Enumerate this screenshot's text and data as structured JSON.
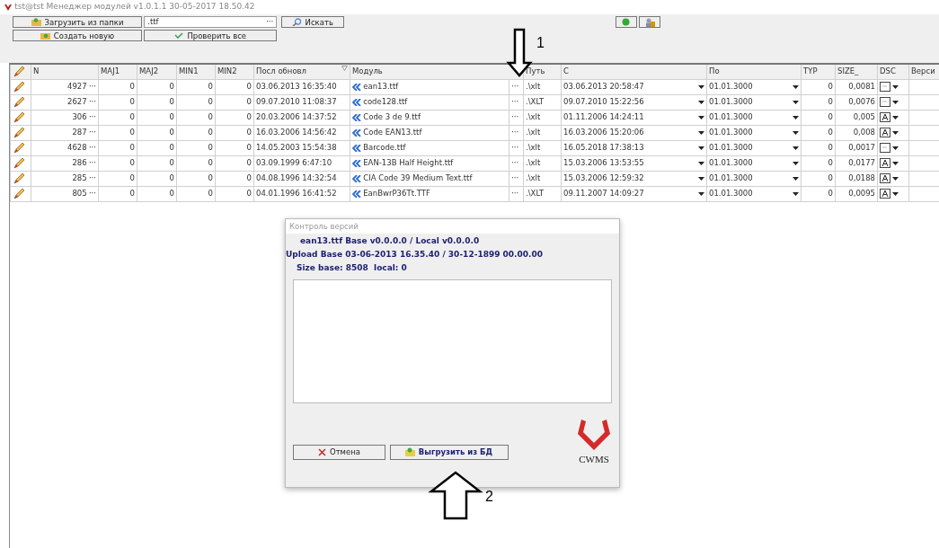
{
  "window": {
    "title": "tst@tst Менеджер модулей v1.0.1.1 30-05-2017 18.50.42"
  },
  "toolbar": {
    "load_button": "Загрузить из папки",
    "filter": {
      "value": ".ttf",
      "browse": "···"
    },
    "search_button": "Искать",
    "create_button": "Создать новую",
    "check_button": "Проверить все"
  },
  "table": {
    "columns": [
      "N",
      "MAJ1",
      "MAJ2",
      "MIN1",
      "MIN2",
      "Посл обновл",
      "Модуль",
      "Путь",
      "С",
      "По",
      "TYP",
      "SIZE_",
      "DSC",
      "Верси"
    ],
    "rows": [
      {
        "n": "4927",
        "n_button": "···",
        "maj1": "0",
        "maj2": "0",
        "min1": "0",
        "min2": "0",
        "updated": "03.06.2013 16:35:40",
        "module": "ean13.ttf",
        "module_button": "···",
        "path": ".\\xlt",
        "from": "03.06.2013 20:58:47",
        "to": "01.01.3000",
        "typ": "0",
        "size": "0,0081",
        "dsc": {
          "kind": "doc"
        }
      },
      {
        "n": "2627",
        "n_button": "···",
        "maj1": "0",
        "maj2": "0",
        "min1": "0",
        "min2": "0",
        "updated": "09.07.2010 11:08:37",
        "module": "code128.ttf",
        "module_button": "···",
        "path": ".\\XLT",
        "from": "09.07.2010 15:22:56",
        "to": "01.01.3000",
        "typ": "0",
        "size": "0,0076",
        "dsc": {
          "kind": "doc"
        }
      },
      {
        "n": "306",
        "n_button": "···",
        "maj1": "0",
        "maj2": "0",
        "min1": "0",
        "min2": "0",
        "updated": "20.03.2006 14:37:52",
        "module": "Code 3 de 9.ttf",
        "module_button": "···",
        "path": ".\\xlt",
        "from": "01.11.2006 14:24:11",
        "to": "01.01.3000",
        "typ": "0",
        "size": "0,005",
        "dsc": {
          "kind": "font"
        }
      },
      {
        "n": "287",
        "n_button": "···",
        "maj1": "0",
        "maj2": "0",
        "min1": "0",
        "min2": "0",
        "updated": "16.03.2006 14:56:42",
        "module": "Code EAN13.ttf",
        "module_button": "···",
        "path": ".\\xlt",
        "from": "16.03.2006 15:20:06",
        "to": "01.01.3000",
        "typ": "0",
        "size": "0,008",
        "dsc": {
          "kind": "font"
        }
      },
      {
        "n": "4628",
        "n_button": "···",
        "maj1": "0",
        "maj2": "0",
        "min1": "0",
        "min2": "0",
        "updated": "14.05.2003 15:54:38",
        "module": "Barcode.ttf",
        "module_button": "···",
        "path": ".\\xlt",
        "from": "16.05.2018 17:38:13",
        "to": "01.01.3000",
        "typ": "0",
        "size": "0,0017",
        "dsc": {
          "kind": "doc"
        }
      },
      {
        "n": "286",
        "n_button": "···",
        "maj1": "0",
        "maj2": "0",
        "min1": "0",
        "min2": "0",
        "updated": "03.09.1999 6:47:10",
        "module": "EAN-13B Half Height.ttf",
        "module_button": "···",
        "path": ".\\xlt",
        "from": "15.03.2006 13:53:55",
        "to": "01.01.3000",
        "typ": "0",
        "size": "0,0177",
        "dsc": {
          "kind": "font"
        }
      },
      {
        "n": "285",
        "n_button": "···",
        "maj1": "0",
        "maj2": "0",
        "min1": "0",
        "min2": "0",
        "updated": "04.08.1996 14:32:54",
        "module": "CIA Code 39 Medium Text.ttf",
        "module_button": "···",
        "path": ".\\xlt",
        "from": "15.03.2006 12:59:32",
        "to": "01.01.3000",
        "typ": "0",
        "size": "0,0188",
        "dsc": {
          "kind": "font"
        }
      },
      {
        "n": "805",
        "n_button": "···",
        "maj1": "0",
        "maj2": "0",
        "min1": "0",
        "min2": "0",
        "updated": "04.01.1996 16:41:52",
        "module": "EanBwrP36Tt.TTF",
        "module_button": "···",
        "path": ".\\XLT",
        "from": "09.11.2007 14:09:27",
        "to": "01.01.3000",
        "typ": "0",
        "size": "0,0095",
        "dsc": {
          "kind": "font"
        }
      }
    ]
  },
  "dialog": {
    "title": "Контроль версий",
    "lines": [
      "ean13.ttf Base v0.0.0.0 / Local v0.0.0.0",
      "Upload Base 03-06-2013 16.35.40 / 30-12-1899 00.00.00",
      "Size base: 8508  local: 0"
    ],
    "cancel_button": "Отмена",
    "export_button": "Выгрузить из БД",
    "logo": "CWMS"
  },
  "annotations": [
    {
      "label": "1"
    },
    {
      "label": "2"
    }
  ]
}
